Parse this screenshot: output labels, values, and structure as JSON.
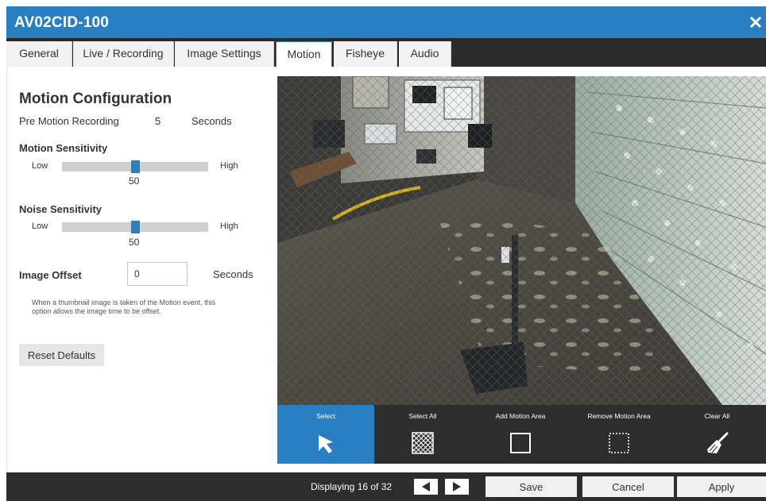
{
  "window": {
    "title": "AV02CID-100",
    "close_icon": "close-icon"
  },
  "tabs": [
    {
      "label": "General"
    },
    {
      "label": "Live / Recording"
    },
    {
      "label": "Image Settings"
    },
    {
      "label": "Motion",
      "active": true
    },
    {
      "label": "Fisheye"
    },
    {
      "label": "Audio"
    }
  ],
  "config": {
    "title": "Motion Configuration",
    "pre_motion": {
      "label": "Pre Motion Recording",
      "value": "5",
      "unit": "Seconds"
    },
    "motion_sensitivity": {
      "label": "Motion Sensitivity",
      "low": "Low",
      "high": "High",
      "value": "50",
      "level": 0.5
    },
    "noise_sensitivity": {
      "label": "Noise Sensitivity",
      "low": "Low",
      "high": "High",
      "value": "50",
      "level": 0.5
    },
    "image_offset": {
      "label": "Image Offset",
      "value": "0",
      "unit": "Seconds"
    },
    "note": "When a thumbnail image is taken of the Motion event, this option allows the image time to be offset.",
    "reset_label": "Reset Defaults"
  },
  "tools": [
    {
      "label": "Select",
      "icon": "cursor-arrow-icon",
      "selected": true
    },
    {
      "label": "Select All",
      "icon": "grid-pattern-icon"
    },
    {
      "label": "Add Motion Area",
      "icon": "square-outline-icon"
    },
    {
      "label": "Remove Motion Area",
      "icon": "dashed-square-icon"
    },
    {
      "label": "Clear All",
      "icon": "broom-icon"
    }
  ],
  "footer": {
    "display_text": "Displaying 16 of 32",
    "prev_icon": "prev-arrow-icon",
    "next_icon": "next-arrow-icon",
    "save_label": "Save",
    "cancel_label": "Cancel",
    "apply_label": "Apply"
  },
  "colors": {
    "accent": "#2a7fc2",
    "dark": "#2d2d2d",
    "tab_bar": "#2a2a2a"
  }
}
